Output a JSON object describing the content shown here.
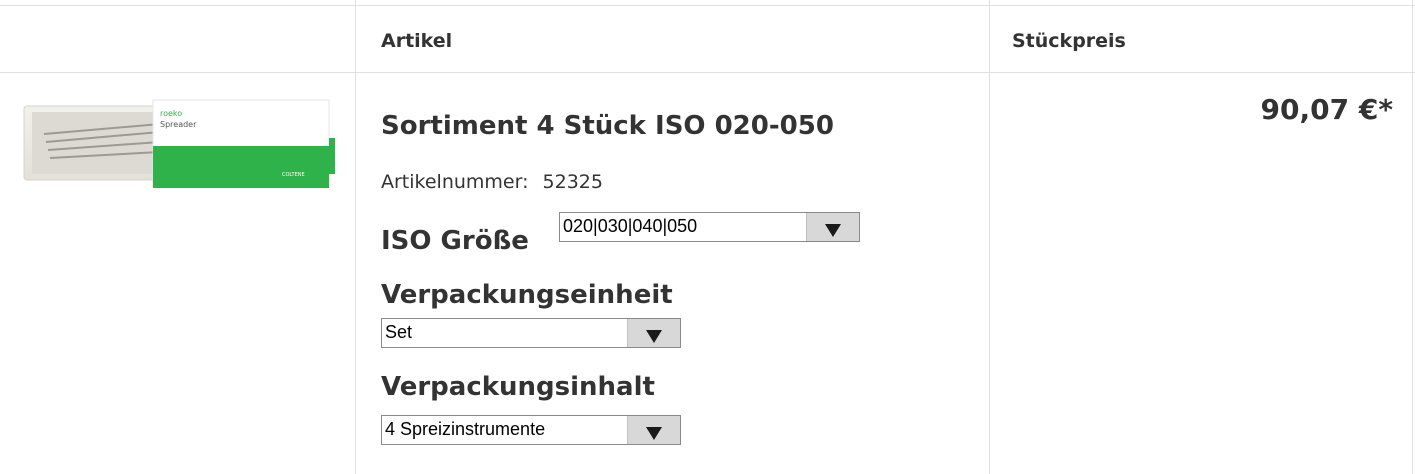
{
  "table": {
    "headers": {
      "article": "Artikel",
      "unit_price": "Stückpreis"
    }
  },
  "product": {
    "image_brand": "roeko",
    "image_name": "Spreader",
    "image_maker": "COLTENE",
    "title": "Sortiment 4 Stück ISO 020-050",
    "article_number_label": "Artikelnummer:",
    "article_number": "52325",
    "price": "90,07 €*"
  },
  "options": {
    "iso_size": {
      "label": "ISO Größe",
      "selected": "020|030|040|050"
    },
    "packaging_unit": {
      "label": "Verpackungseinheit",
      "selected": "Set"
    },
    "packaging_content": {
      "label": "Verpackungsinhalt",
      "selected": "4 Spreizinstrumente"
    }
  },
  "colors": {
    "accent_green": "#2fb24a",
    "border": "#e0e0e0",
    "select_button": "#d8d8d8"
  },
  "icons": {
    "select_arrow": "chevron-down-icon"
  }
}
